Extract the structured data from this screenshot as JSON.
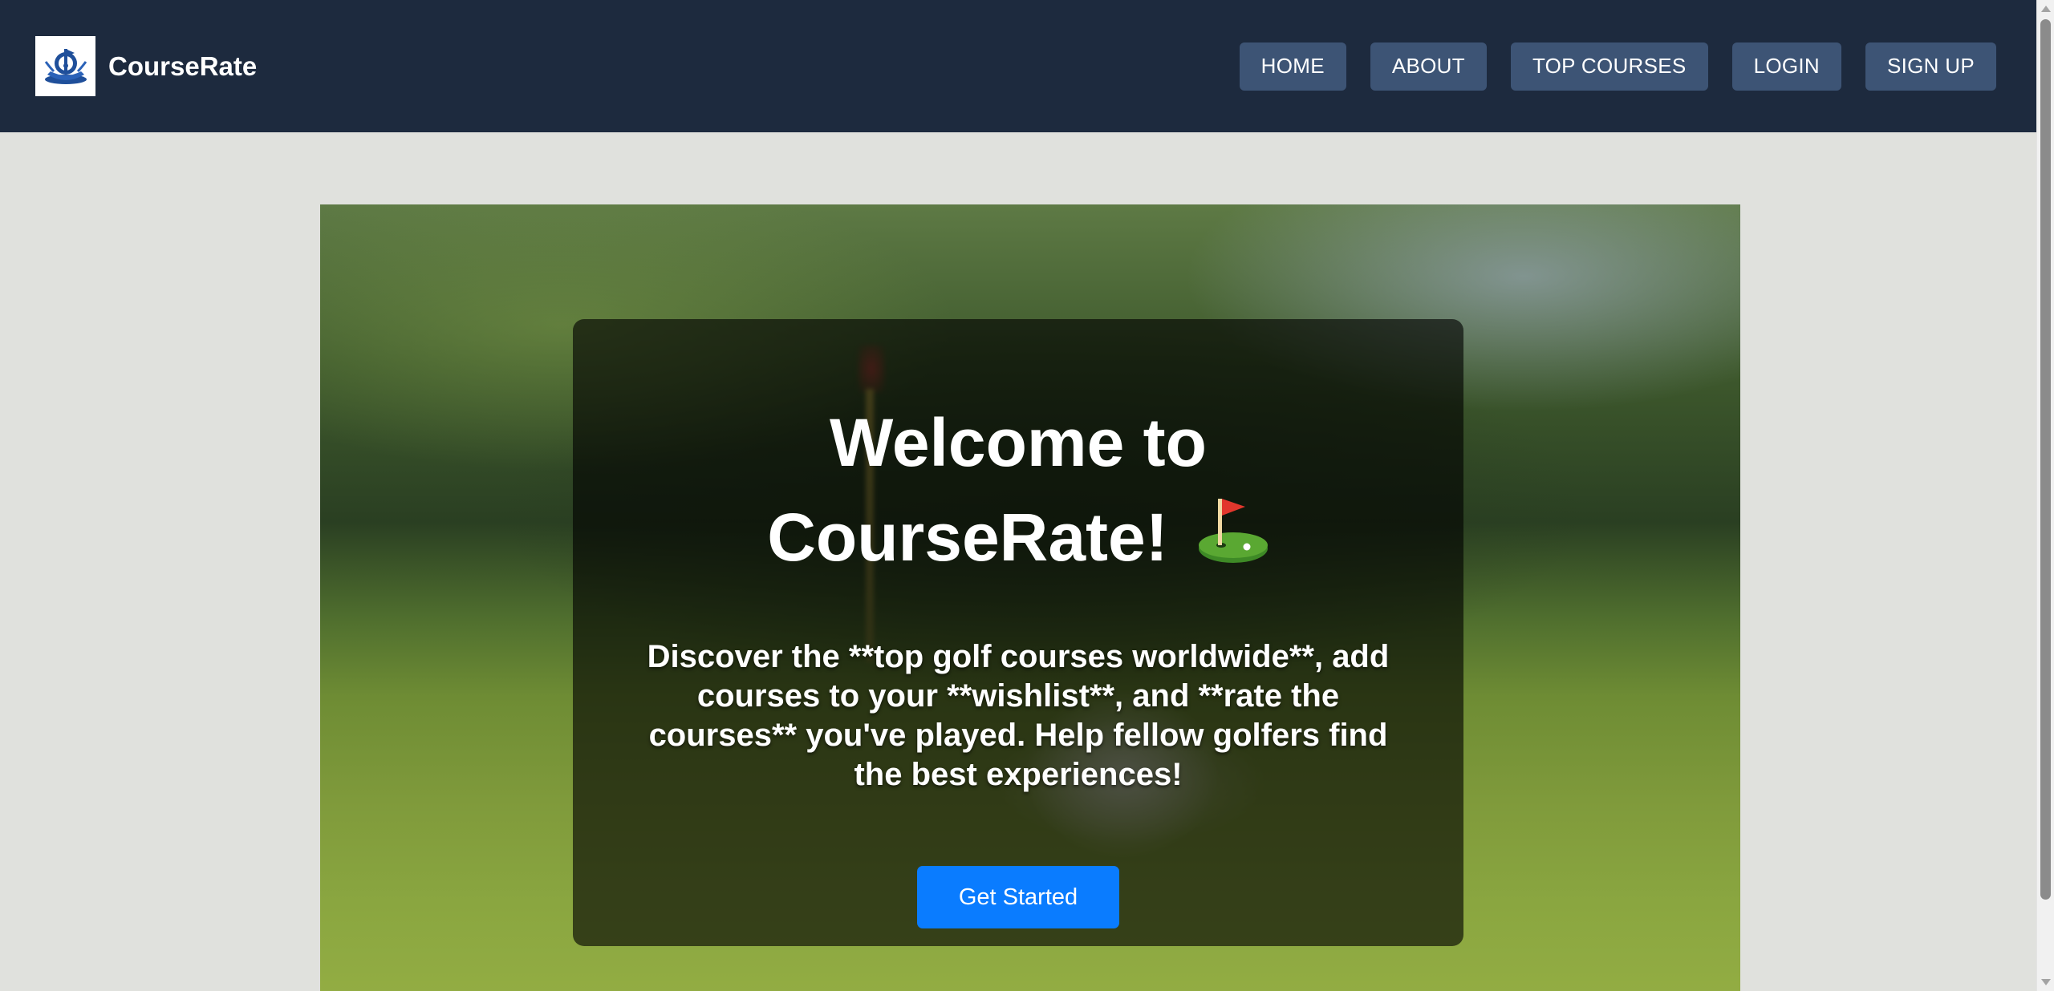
{
  "header": {
    "brand_name": "CourseRate",
    "nav": [
      {
        "label": "HOME"
      },
      {
        "label": "ABOUT"
      },
      {
        "label": "TOP COURSES"
      },
      {
        "label": "LOGIN"
      },
      {
        "label": "SIGN UP"
      }
    ]
  },
  "hero": {
    "title_line1": "Welcome to",
    "title_line2": "CourseRate!",
    "title_icon": "golf-flag-icon",
    "description": "Discover the **top golf courses worldwide**, add courses to your **wishlist**, and **rate the courses** you've played. Help fellow golfers find the best experiences!",
    "cta_label": "Get Started"
  },
  "colors": {
    "navbar": "#1d2a3e",
    "nav_button": "#3d5475",
    "page_bg": "#e0e1dd",
    "cta": "#0a7cff"
  }
}
